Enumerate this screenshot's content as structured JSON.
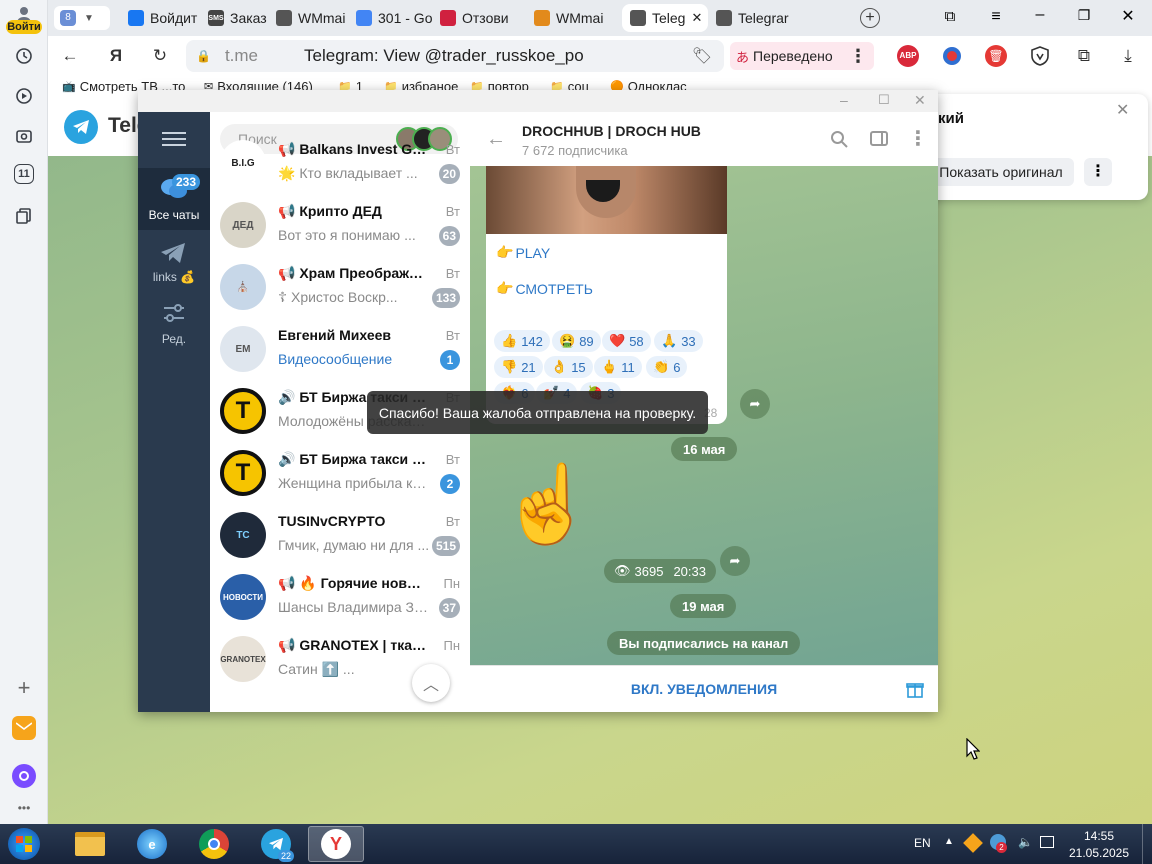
{
  "browser": {
    "profile_label": "Войти",
    "tab_count": "8",
    "tabs": [
      {
        "label": "Войдит",
        "icon": "facebook-icon",
        "color": "#1877f2"
      },
      {
        "label": "Заказ н",
        "icon": "sms-icon",
        "color": "#444444",
        "text": "SMS"
      },
      {
        "label": "WMmai",
        "icon": "page-icon",
        "color": "#555555"
      },
      {
        "label": "301 - Go",
        "icon": "docs-icon",
        "color": "#4285f4"
      },
      {
        "label": "Отзови",
        "icon": "otzovik-icon",
        "color": "#d0213f"
      },
      {
        "label": "WMmai",
        "icon": "wm-icon",
        "color": "#e28a1c"
      },
      {
        "label": "Teleg",
        "icon": "page-icon",
        "color": "#555555",
        "active": true
      },
      {
        "label": "Telegrar",
        "icon": "page-icon",
        "color": "#555555"
      }
    ],
    "url_host": "t.me",
    "url_title": "Telegram: View @trader_russkoe_po",
    "translated_label": "Переведено",
    "ext_abp": "ABP",
    "bookmarks": [
      {
        "label": "Смотреть ТВ ...то",
        "icon": "tv-icon"
      },
      {
        "label": "Входящие (146)",
        "icon": "gmail-icon"
      },
      {
        "label": "1",
        "icon": "folder-icon"
      },
      {
        "label": "избраное",
        "icon": "folder-icon"
      },
      {
        "label": "повтор",
        "icon": "folder-icon"
      },
      {
        "label": "соц",
        "icon": "folder-icon"
      },
      {
        "label": "Одноклас",
        "icon": "ok-icon"
      }
    ],
    "side_badge": "11"
  },
  "page_header": {
    "title_fragment": "Tele"
  },
  "translate_popup": {
    "text_fragment": "кий",
    "show_original": "Показать оригинал"
  },
  "telegram": {
    "nav": [
      {
        "label": "Все чаты",
        "badge": "233",
        "icon": "chats-icon"
      },
      {
        "label": "links 💰",
        "icon": "send-icon"
      },
      {
        "label": "Ред.",
        "icon": "sliders-icon"
      }
    ],
    "search_placeholder": "Поиск",
    "chats": [
      {
        "name": "📢 Balkans Invest Group...",
        "time": "Вт",
        "preview": "🌟 Кто вкладывает ...",
        "badge": "20",
        "blue": false,
        "ava_text": "B.I.G",
        "ava_bg": "#ffffff",
        "ava_fg": "#222222"
      },
      {
        "name": "📢 Крипто ДЕД",
        "time": "Вт",
        "preview": "Вот это я понимаю ...",
        "badge": "63",
        "blue": false,
        "ava_text": "ДЕД",
        "ava_bg": "#d9d5c8",
        "ava_fg": "#555555"
      },
      {
        "name": "📢 Храм Преображени...",
        "time": "Вт",
        "preview": "☦ Христос Воскр...",
        "badge": "133",
        "blue": false,
        "ava_text": "⛪",
        "ava_bg": "#c7d7e8",
        "ava_fg": "#555555"
      },
      {
        "name": "Евгений Михеев",
        "time": "Вт",
        "preview": "Видеосообщение",
        "badge": "1",
        "blue": true,
        "ava_text": "ЕМ",
        "ava_bg": "#dfe6ee",
        "ava_fg": "#555555",
        "preview_blue": true
      },
      {
        "name": "🔊 БТ Биржа такси Ров...",
        "time": "Вт",
        "preview": "Молодожёны рассказываю...",
        "badge": "",
        "blue": false,
        "ava_text": "T",
        "ava_bg": "#f6c400",
        "ava_fg": "#111111"
      },
      {
        "name": "🔊 БТ Биржа такси Ров...",
        "time": "Вт",
        "preview": "Женщина прибыла к вр...",
        "badge": "2",
        "blue": true,
        "ava_text": "T",
        "ava_bg": "#f6c400",
        "ava_fg": "#111111"
      },
      {
        "name": "TUSINvCRYPTO",
        "time": "Вт",
        "preview": "Гмчик, думаю ни для ...",
        "badge": "515",
        "blue": false,
        "ava_text": "TC",
        "ava_bg": "#1f2a3a",
        "ava_fg": "#7fd0ff"
      },
      {
        "name": "📢 🔥 Горячие новост...",
        "time": "Пн",
        "preview": "Шансы Владимира Зел...",
        "badge": "37",
        "blue": false,
        "ava_text": "НОВОСТИ",
        "ava_bg": "#2a5fa8",
        "ava_fg": "#ffffff"
      },
      {
        "name": "📢 GRANOTEX | ткани",
        "time": "Пн",
        "preview": "Сатин ⬆️ ...",
        "badge": "",
        "blue": false,
        "ava_text": "GRANOTEX",
        "ava_bg": "#e8e2d8",
        "ava_fg": "#444444"
      }
    ],
    "channel_title": "DROCHHUB | DROCH HUB",
    "channel_subs": "7 672 подписчика",
    "link_play": "PLAY",
    "link_watch": "СМОТРЕТЬ",
    "reactions": [
      {
        "emoji": "👍",
        "count": "142"
      },
      {
        "emoji": "🤮",
        "count": "89"
      },
      {
        "emoji": "❤️",
        "count": "58"
      },
      {
        "emoji": "🙏",
        "count": "33"
      },
      {
        "emoji": "👎",
        "count": "21"
      },
      {
        "emoji": "👌",
        "count": "15"
      },
      {
        "emoji": "🖕",
        "count": "11"
      },
      {
        "emoji": "👏",
        "count": "6"
      },
      {
        "emoji": "❤️‍🔥",
        "count": "6"
      },
      {
        "emoji": "💅",
        "count": "4"
      },
      {
        "emoji": "🍓",
        "count": "3"
      }
    ],
    "msg_time_partial": "28",
    "date1": "16 мая",
    "views": "3695",
    "time2": "20:33",
    "date2": "19 мая",
    "service_msg": "Вы подписались на канал",
    "toast": "Спасибо! Ваша жалоба отправлена на проверку.",
    "footer_btn": "ВКЛ. УВЕДОМЛЕНИЯ"
  },
  "taskbar": {
    "lang": "EN",
    "time": "14:55",
    "date": "21.05.2025",
    "telegram_badge": "22",
    "tray_badge": "2"
  }
}
